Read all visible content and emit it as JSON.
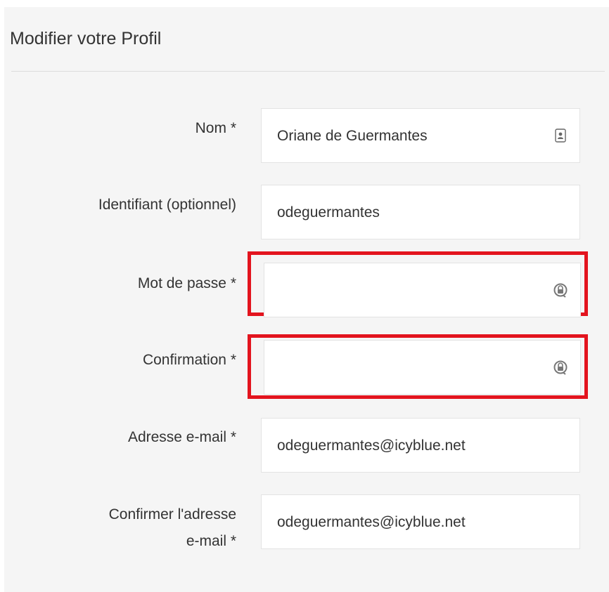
{
  "form": {
    "title": "Modifier votre Profil",
    "fields": [
      {
        "label": "Nom *",
        "value": "Oriane de Guermantes",
        "icon": "contact-card-icon"
      },
      {
        "label": "Identifiant (optionnel)",
        "value": "odeguermantes"
      },
      {
        "label": "Mot de passe *",
        "value": "",
        "icon": "password-manager-icon",
        "highlighted": true
      },
      {
        "label": "Confirmation *",
        "value": "",
        "icon": "password-manager-icon",
        "highlighted": true
      },
      {
        "label": "Adresse e-mail *",
        "value": "odeguermantes@icyblue.net"
      },
      {
        "label_line1": "Confirmer l'adresse",
        "label_line2": "e-mail *",
        "value": "odeguermantes@icyblue.net"
      }
    ]
  },
  "colors": {
    "highlight": "#e3141e",
    "panel_background": "#f5f5f5",
    "input_border": "#e3e3e3"
  }
}
